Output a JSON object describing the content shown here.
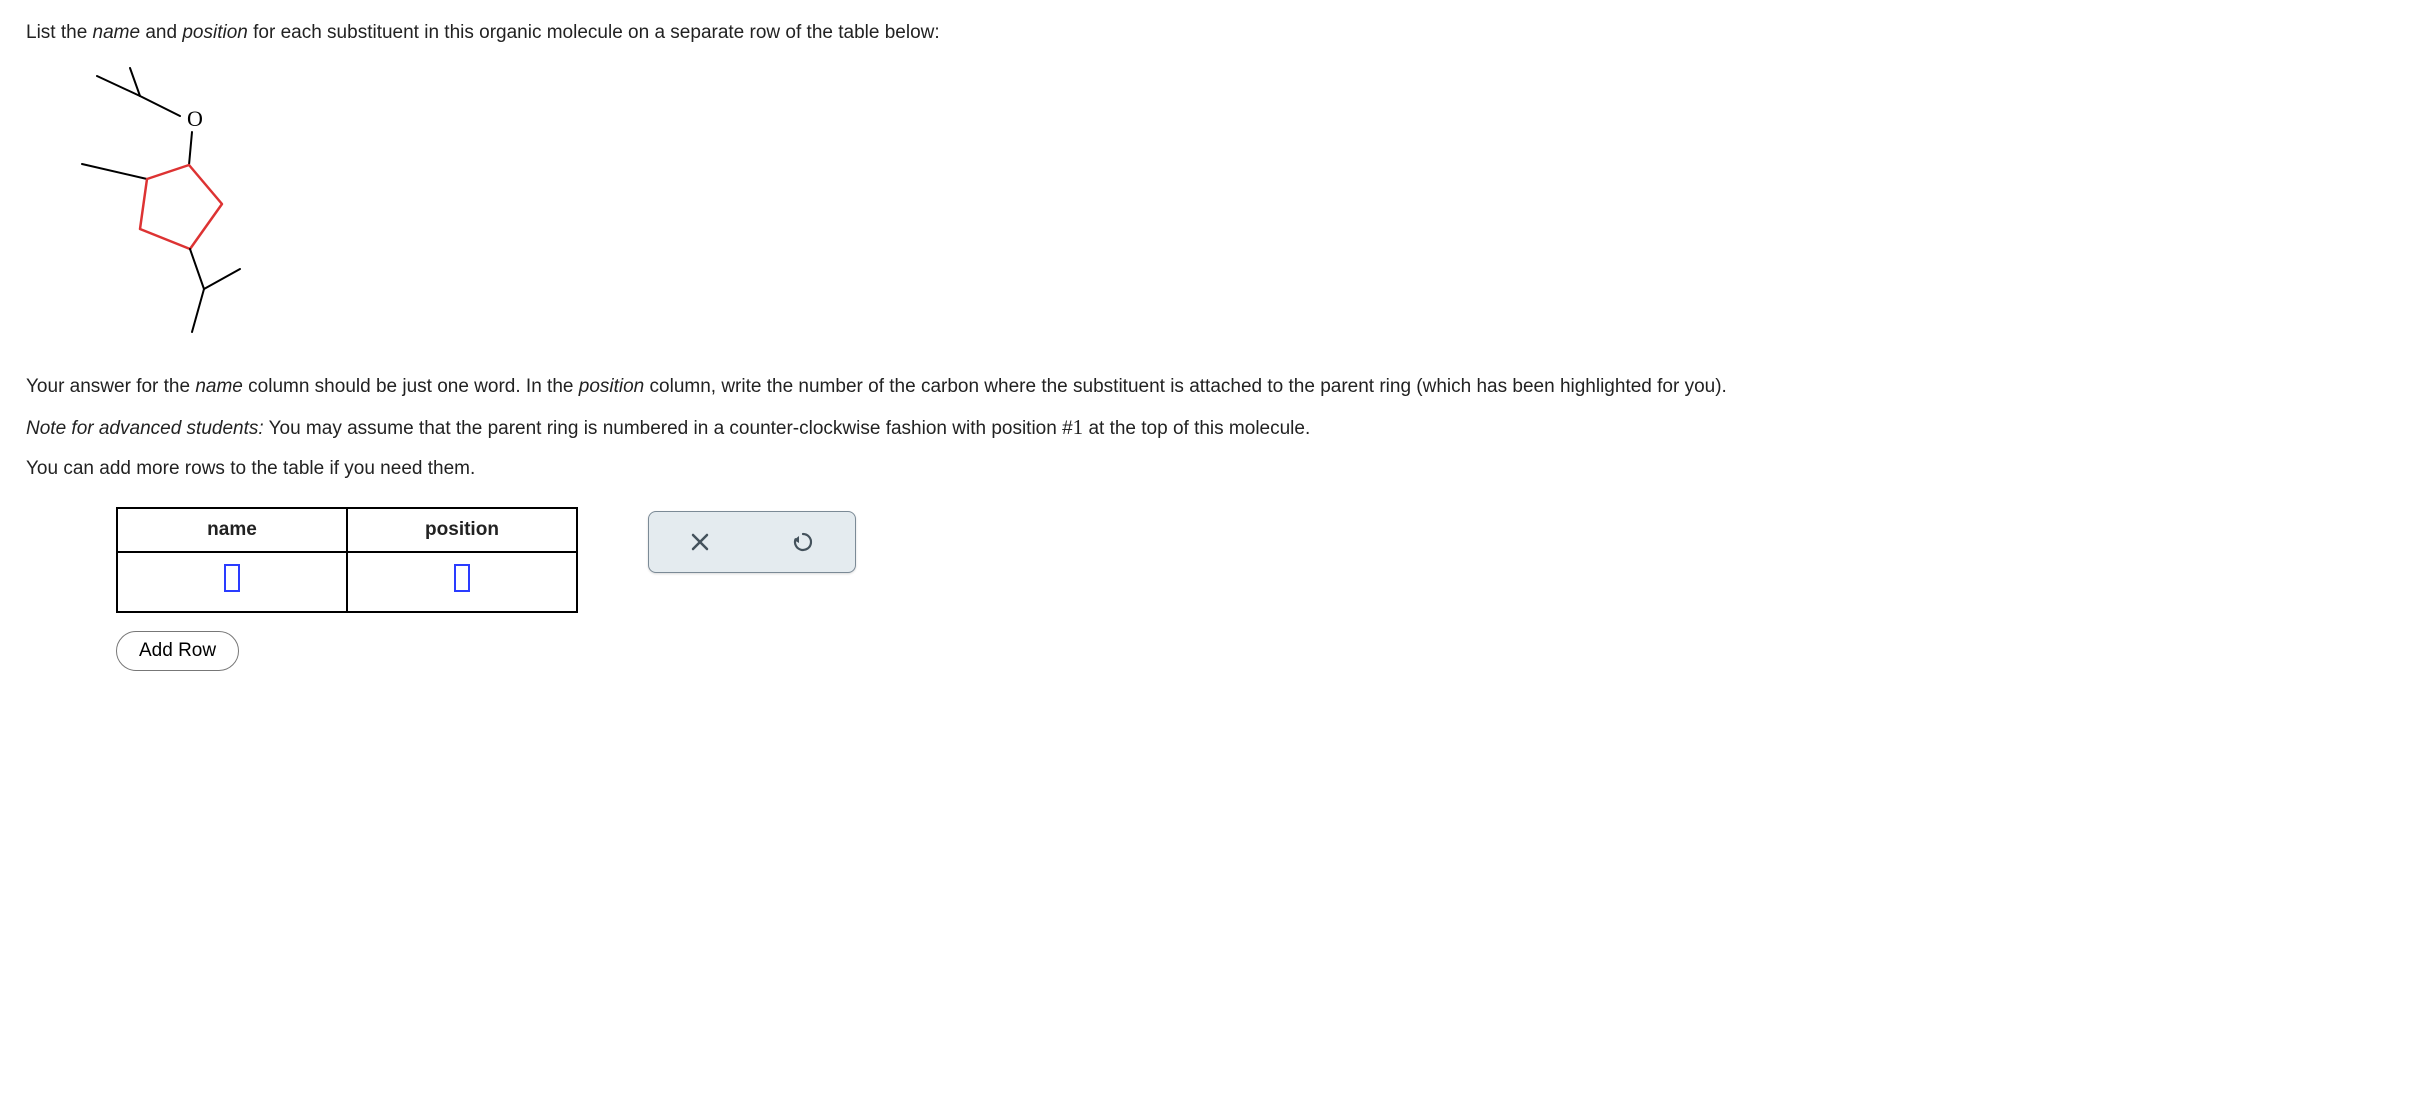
{
  "prompt": {
    "lead": "List the ",
    "name_word": "name",
    "mid1": " and ",
    "position_word": "position",
    "tail1": " for each substituent in this organic molecule on a separate row of the table below:"
  },
  "molecule": {
    "atom_label": "O"
  },
  "instructions": {
    "p1_a": "Your answer for the ",
    "p1_name": "name",
    "p1_b": " column should be just one word. In the ",
    "p1_position": "position",
    "p1_c": " column, write the number of the carbon where the substituent is attached to the parent ring (which has been highlighted for you).",
    "p2_a": "Note for advanced students:",
    "p2_b": " You may assume that the parent ring is numbered in a counter-clockwise fashion with position #",
    "p2_num": "1",
    "p2_c": " at the top of this molecule.",
    "p3": "You can add more rows to the table if you need them."
  },
  "table": {
    "headers": {
      "name": "name",
      "position": "position"
    }
  },
  "buttons": {
    "add_row": "Add Row"
  }
}
